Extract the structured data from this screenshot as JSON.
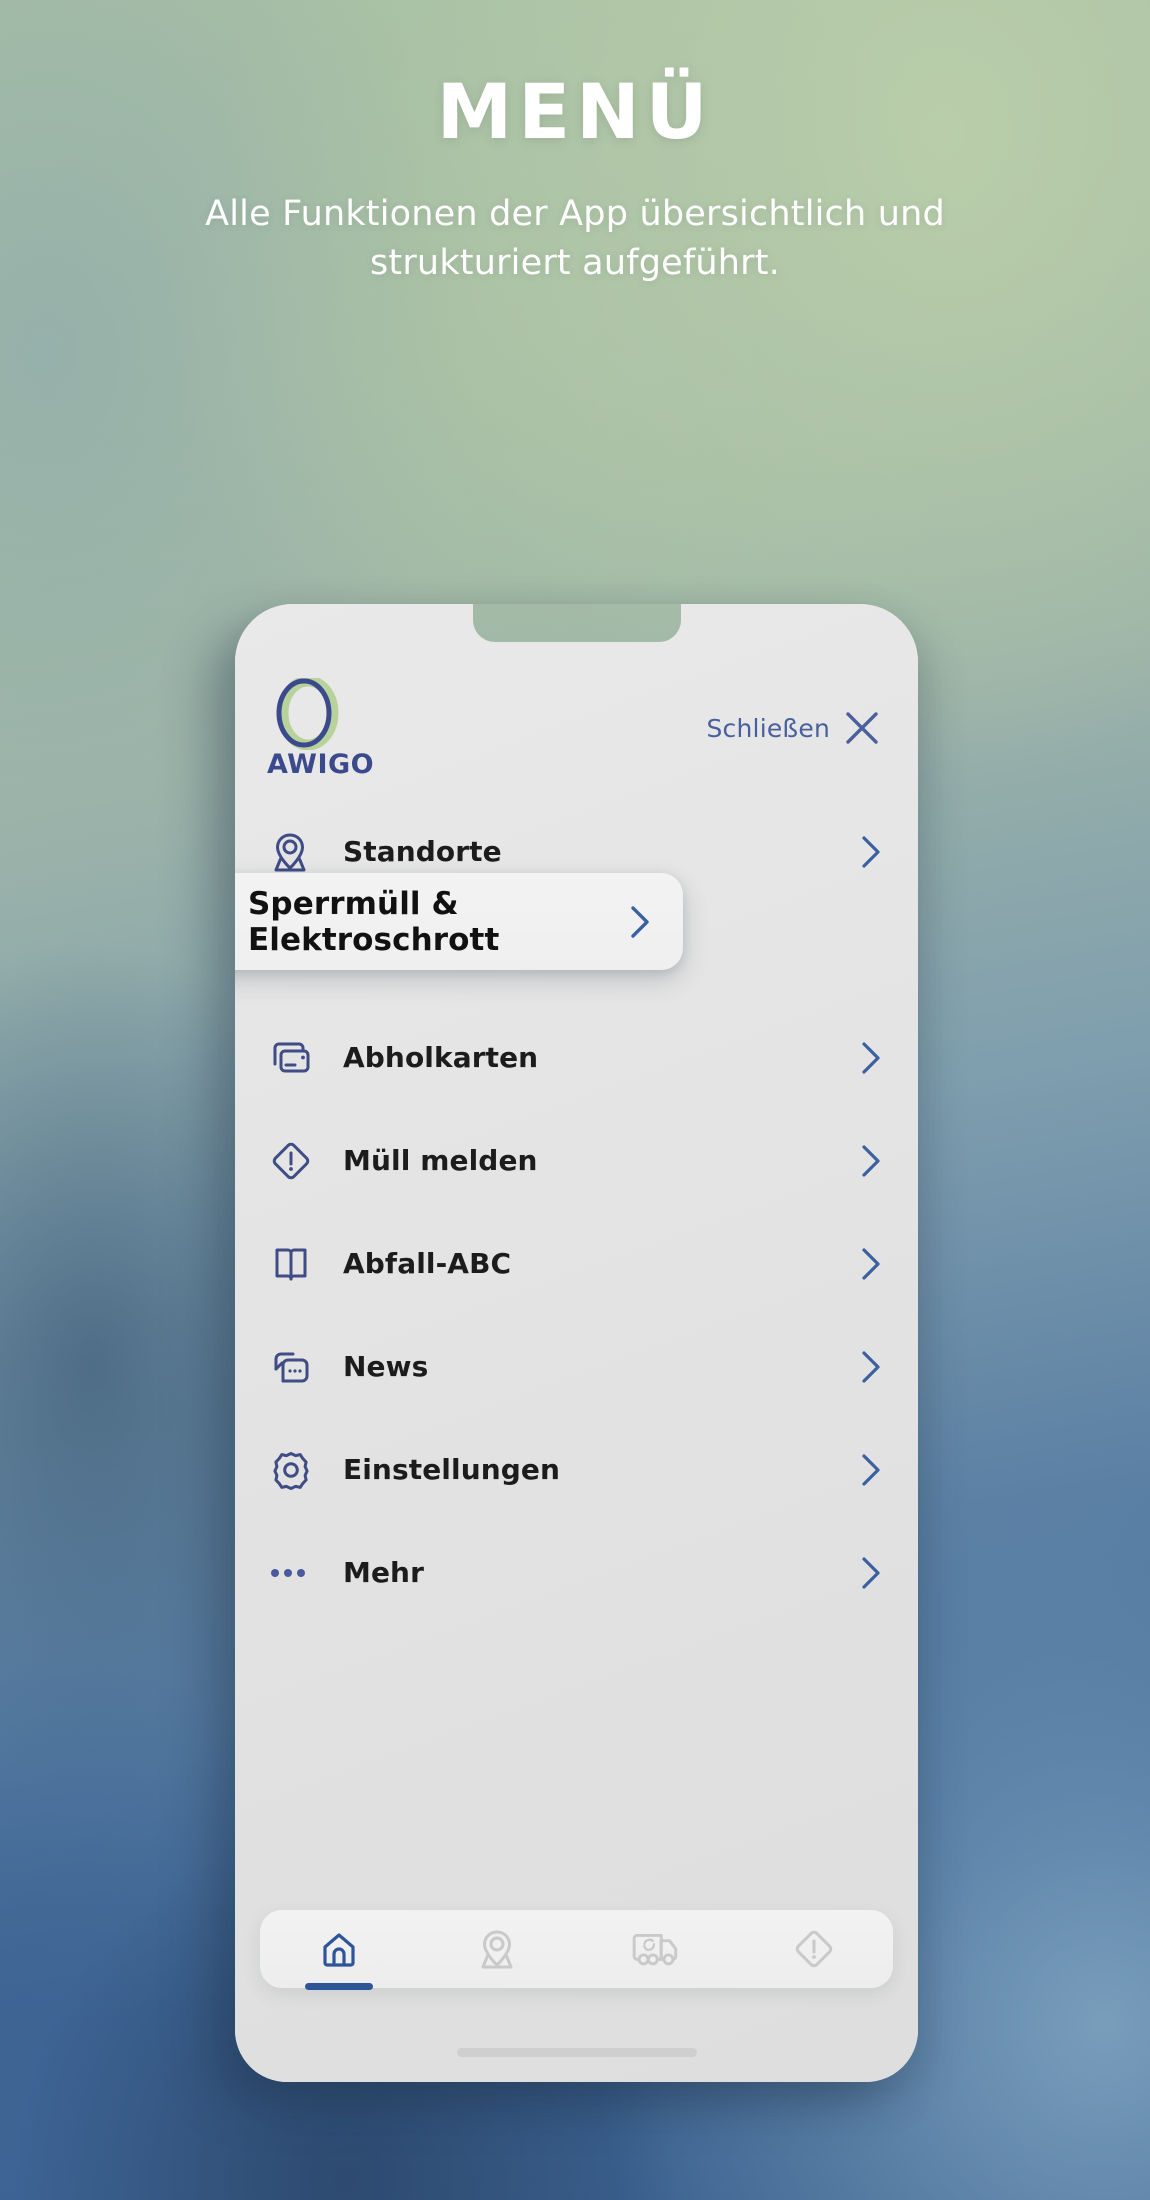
{
  "hero": {
    "title": "MENÜ",
    "subtitle": "Alle Funktionen der App übersichtlich und strukturiert aufgeführt."
  },
  "colors": {
    "brand_blue": "#3b4a8c",
    "icon_blue": "#3f4c85",
    "link_blue": "#49609c",
    "chevron_blue": "#3a60a0",
    "accent_green": "#b7d29a",
    "tab_active": "#2f5599",
    "tab_inactive": "#c9c9c9",
    "label_dark": "#1c1c1c",
    "phone_body": "#e4e4e4",
    "bg_green": "#a9c1a4",
    "bg_blue": "#3c6392"
  },
  "app_header": {
    "logo_text": "AWIGO",
    "logo_icon": "awigo-ring-logo",
    "close_label": "Schließen",
    "close_icon": "close-x-icon"
  },
  "menu": {
    "items": [
      {
        "label": "Standorte",
        "icon": "location-pin-icon",
        "highlighted": false
      },
      {
        "label": "Sperrmüll & Elektroschrott",
        "icon": "recycling-truck-icon",
        "highlighted": true
      },
      {
        "label": "Abholkarten",
        "icon": "cards-icon",
        "highlighted": false
      },
      {
        "label": "Müll melden",
        "icon": "alert-diamond-icon",
        "highlighted": false
      },
      {
        "label": "Abfall-ABC",
        "icon": "open-book-icon",
        "highlighted": false
      },
      {
        "label": "News",
        "icon": "chat-bubble-icon",
        "highlighted": false
      },
      {
        "label": "Einstellungen",
        "icon": "gear-icon",
        "highlighted": false
      },
      {
        "label": "Mehr",
        "icon": "ellipsis-icon",
        "highlighted": false
      }
    ],
    "chevron_icon": "chevron-right-icon"
  },
  "tabbar": {
    "tabs": [
      {
        "name": "home",
        "icon": "home-icon",
        "active": true
      },
      {
        "name": "standorte",
        "icon": "location-pin-icon",
        "active": false
      },
      {
        "name": "sperrmuell",
        "icon": "recycling-truck-icon",
        "active": false
      },
      {
        "name": "melden",
        "icon": "alert-diamond-icon",
        "active": false
      }
    ]
  }
}
